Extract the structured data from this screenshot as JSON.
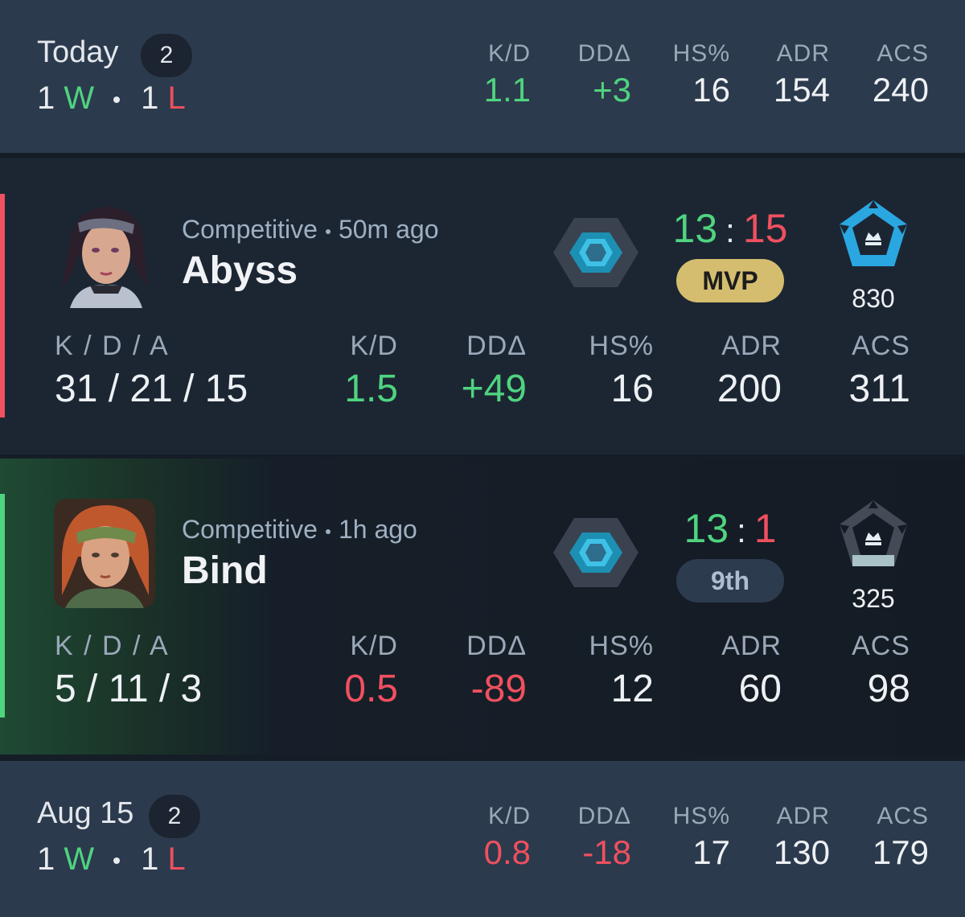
{
  "today": {
    "title": "Today",
    "count": "2",
    "wins": "1",
    "win_letter": "W",
    "losses": "1",
    "loss_letter": "L",
    "stats": {
      "kd_label": "K/D",
      "kd": "1.1",
      "dda_label": "DDΔ",
      "dda": "+3",
      "hs_label": "HS%",
      "hs": "16",
      "adr_label": "ADR",
      "adr": "154",
      "acs_label": "ACS",
      "acs": "240"
    }
  },
  "matches": [
    {
      "result": "loss",
      "mode": "Competitive",
      "time": "50m ago",
      "map": "Abyss",
      "score_team": "13",
      "score_sep": ":",
      "score_enemy": "15",
      "badge": "MVP",
      "rr": "830",
      "stats": {
        "kda_label": "K / D / A",
        "kda": "31 / 21 / 15",
        "kd_label": "K/D",
        "kd": "1.5",
        "dda_label": "DDΔ",
        "dda": "+49",
        "hs_label": "HS%",
        "hs": "16",
        "adr_label": "ADR",
        "adr": "200",
        "acs_label": "ACS",
        "acs": "311"
      }
    },
    {
      "result": "win",
      "mode": "Competitive",
      "time": "1h ago",
      "map": "Bind",
      "score_team": "13",
      "score_sep": ":",
      "score_enemy": "1",
      "badge": "9th",
      "rr": "325",
      "stats": {
        "kda_label": "K / D / A",
        "kda": "5 / 11 / 3",
        "kd_label": "K/D",
        "kd": "0.5",
        "dda_label": "DDΔ",
        "dda": "-89",
        "hs_label": "HS%",
        "hs": "12",
        "adr_label": "ADR",
        "adr": "60",
        "acs_label": "ACS",
        "acs": "98"
      }
    }
  ],
  "previous_day": {
    "title": "Aug 15",
    "count": "2",
    "wins": "1",
    "win_letter": "W",
    "losses": "1",
    "loss_letter": "L",
    "stats": {
      "kd_label": "K/D",
      "kd": "0.8",
      "dda_label": "DDΔ",
      "dda": "-18",
      "hs_label": "HS%",
      "hs": "17",
      "adr_label": "ADR",
      "adr": "130",
      "acs_label": "ACS",
      "acs": "179"
    }
  },
  "colors": {
    "win": "#4fd47f",
    "loss": "#f0505f",
    "mvp_badge": "#d4bd6e"
  },
  "icons": {
    "agent_1": "agent-portrait-reyna-style",
    "agent_2": "agent-portrait-skye-style",
    "rank": "ascendant-rank-hex-icon",
    "rr_high": "immortal-rank-icon",
    "rr_low": "immortal-rank-grey-icon"
  }
}
